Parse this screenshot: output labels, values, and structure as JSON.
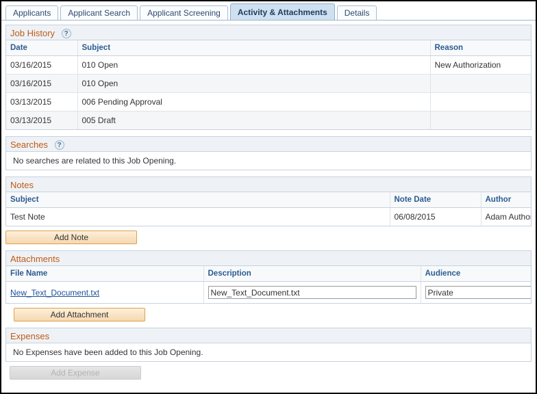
{
  "tabs": [
    {
      "label": "Applicants",
      "active": false
    },
    {
      "label": "Applicant Search",
      "active": false
    },
    {
      "label": "Applicant Screening",
      "active": false
    },
    {
      "label": "Activity & Attachments",
      "active": true
    },
    {
      "label": "Details",
      "active": false
    }
  ],
  "help_glyph": "?",
  "job_history": {
    "title": "Job History",
    "columns": [
      "Date",
      "Subject",
      "Reason"
    ],
    "rows": [
      {
        "date": "03/16/2015",
        "subject": "010 Open",
        "reason": "New Authorization"
      },
      {
        "date": "03/16/2015",
        "subject": "010 Open",
        "reason": ""
      },
      {
        "date": "03/13/2015",
        "subject": "006 Pending Approval",
        "reason": ""
      },
      {
        "date": "03/13/2015",
        "subject": "005 Draft",
        "reason": ""
      }
    ]
  },
  "searches": {
    "title": "Searches",
    "empty_message": "No searches are related to this Job Opening."
  },
  "notes": {
    "title": "Notes",
    "columns": [
      "Subject",
      "Note Date",
      "Author"
    ],
    "rows": [
      {
        "subject": "Test Note",
        "note_date": "06/08/2015",
        "author": "Adam Author"
      }
    ],
    "add_button": "Add Note"
  },
  "attachments": {
    "title": "Attachments",
    "columns": [
      "File Name",
      "Description",
      "Audience"
    ],
    "rows": [
      {
        "file_name": "New_Text_Document.txt",
        "description_value": "New_Text_Document.txt",
        "description_placeholder": "",
        "audience_value": "Private"
      }
    ],
    "add_button": "Add Attachment"
  },
  "expenses": {
    "title": "Expenses",
    "empty_message": "No Expenses have been added to this Job Opening.",
    "add_button": "Add Expense",
    "add_button_disabled": true
  },
  "colors": {
    "section_title": "#c05a16",
    "column_header": "#2c5b91",
    "link": "#1a4f9c",
    "tab_active_bg": "#cfe0f0",
    "button_accent": "#d9a34c"
  }
}
